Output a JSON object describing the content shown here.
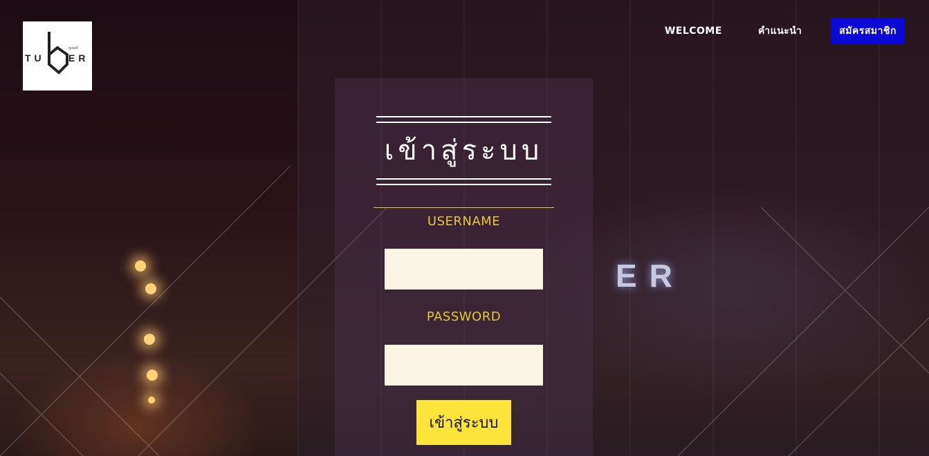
{
  "brand": {
    "logo_text": "TUBER",
    "logo_subtext": "กูเบอร์"
  },
  "nav": {
    "welcome": "WELCOME",
    "guide": "คำแนะนำ",
    "register": "สมัครสมาชิก"
  },
  "login": {
    "title": "เข้าสู่ระบบ",
    "username_label": "USERNAME",
    "username_value": "",
    "password_label": "PASSWORD",
    "password_value": "",
    "submit_label": "เข้าสู่ระบบ"
  },
  "background": {
    "sign_text": "ER"
  },
  "colors": {
    "accent_yellow": "#fde43a",
    "label_yellow": "#e9c635",
    "register_blue": "#0a0ad4",
    "input_bg": "#fbf5e6"
  }
}
